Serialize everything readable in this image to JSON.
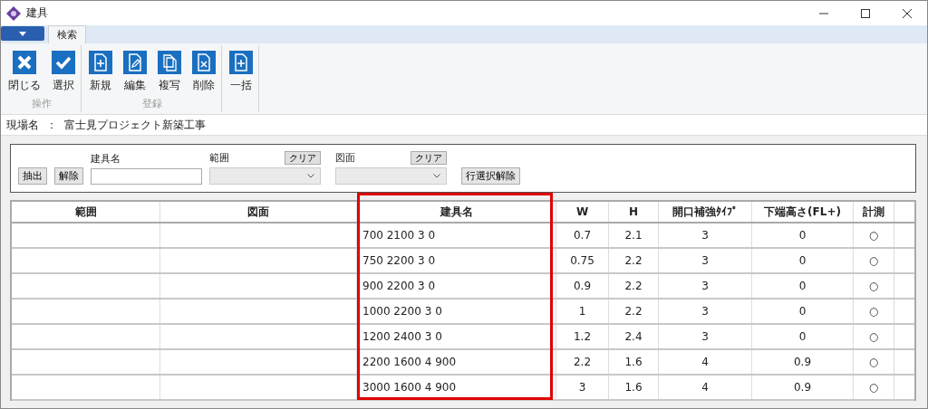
{
  "window": {
    "title": "建具"
  },
  "ribbon": {
    "tabs": [
      {
        "label": "検索",
        "selected": true
      }
    ],
    "groups": [
      {
        "label": "操作",
        "buttons": [
          {
            "label": "閉じる",
            "kind": "close"
          },
          {
            "label": "選択",
            "kind": "check"
          }
        ]
      },
      {
        "label": "登録",
        "buttons": [
          {
            "label": "新規",
            "kind": "new"
          },
          {
            "label": "編集",
            "kind": "edit"
          },
          {
            "label": "複写",
            "kind": "copy"
          },
          {
            "label": "削除",
            "kind": "delete"
          }
        ]
      },
      {
        "buttons": [
          {
            "label": "一括",
            "kind": "new"
          }
        ]
      }
    ]
  },
  "site": {
    "label": "現場名",
    "separator": "：",
    "value": "富士見プロジェクト新築工事"
  },
  "filter": {
    "extract": "抽出",
    "release": "解除",
    "name_label": "建具名",
    "range_label": "範囲",
    "range_clear": "クリア",
    "drawing_label": "図面",
    "drawing_clear": "クリア",
    "row_release": "行選択解除"
  },
  "table": {
    "columns": [
      {
        "label": "範囲",
        "highlighted": false
      },
      {
        "label": "図面",
        "highlighted": false
      },
      {
        "label": "建具名",
        "highlighted": true
      },
      {
        "label": "W",
        "highlighted": false
      },
      {
        "label": "H",
        "highlighted": false
      },
      {
        "label": "開口補強ﾀｲﾌﾟ",
        "highlighted": false
      },
      {
        "label": "下端高さ(FL+)",
        "highlighted": false
      },
      {
        "label": "計測",
        "highlighted": false
      }
    ],
    "rows": [
      [
        "",
        "",
        "700 2100 3 0",
        "0.7",
        "2.1",
        "3",
        "0",
        "○"
      ],
      [
        "",
        "",
        "750 2200 3 0",
        "0.75",
        "2.2",
        "3",
        "0",
        "○"
      ],
      [
        "",
        "",
        "900 2200 3 0",
        "0.9",
        "2.2",
        "3",
        "0",
        "○"
      ],
      [
        "",
        "",
        "1000 2200 3 0",
        "1",
        "2.2",
        "3",
        "0",
        "○"
      ],
      [
        "",
        "",
        "1200 2400 3 0",
        "1.2",
        "2.4",
        "3",
        "0",
        "○"
      ],
      [
        "",
        "",
        "2200 1600 4 900",
        "2.2",
        "1.6",
        "4",
        "0.9",
        "○"
      ],
      [
        "",
        "",
        "3000 1600 4 900",
        "3",
        "1.6",
        "4",
        "0.9",
        "○"
      ]
    ]
  }
}
